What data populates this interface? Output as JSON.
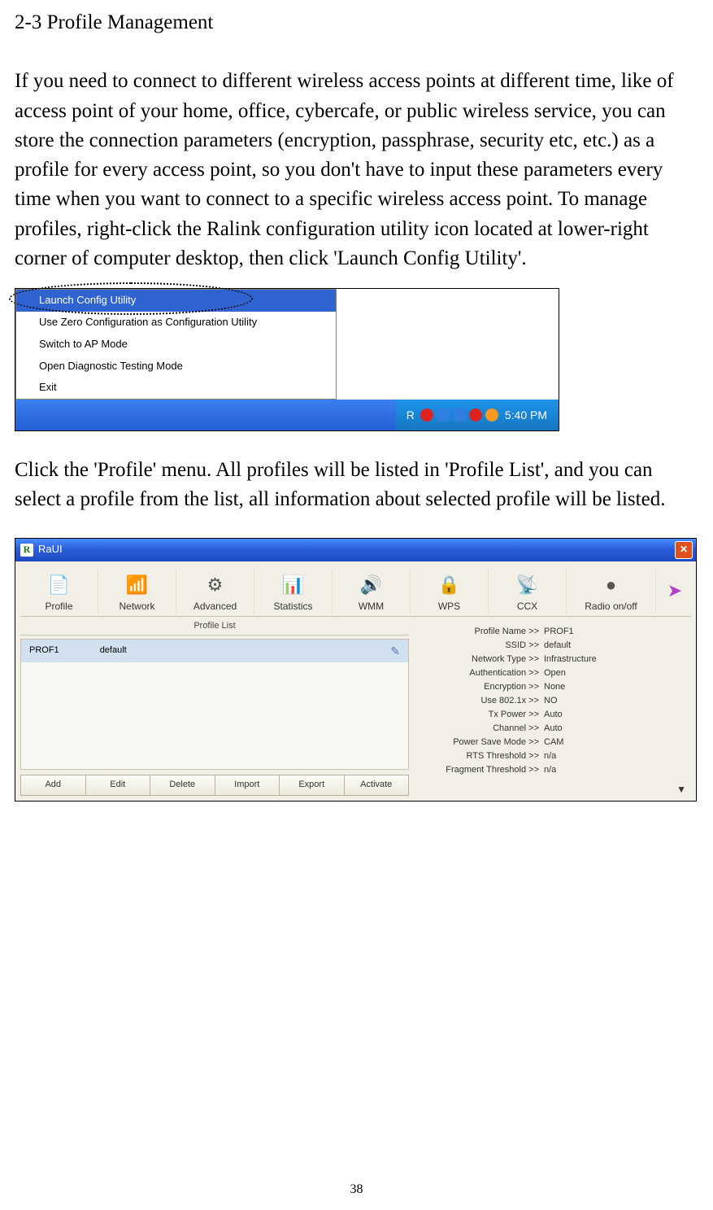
{
  "heading": "2-3 Profile Management",
  "para1": "If you need to connect to different wireless access points at different time, like of access point of your home, office, cybercafe, or public wireless service, you can store the connection parameters (encryption, passphrase, security etc, etc.) as a profile for every access point, so you don't have to input these parameters every time when you want to connect to a specific wireless access point. To manage profiles, right-click the Ralink configuration utility icon located at lower-right corner of computer desktop, then click 'Launch Config Utility'.",
  "context_menu": {
    "items": [
      "Launch Config Utility",
      "Use Zero Configuration as Configuration Utility",
      "Switch to AP Mode",
      "Open Diagnostic Testing Mode",
      "Exit"
    ]
  },
  "taskbar": {
    "clock": "5:40 PM"
  },
  "para2": "Click the 'Profile' menu. All profiles will be listed in 'Profile List', and you can select a profile from the list, all information about selected profile will be listed.",
  "raui": {
    "title": "RaUI",
    "tabs": [
      "Profile",
      "Network",
      "Advanced",
      "Statistics",
      "WMM",
      "WPS",
      "CCX",
      "Radio on/off"
    ],
    "profile_list": {
      "header": "Profile List",
      "rows": [
        {
          "name": "PROF1",
          "ssid": "default"
        }
      ]
    },
    "buttons": [
      "Add",
      "Edit",
      "Delete",
      "Import",
      "Export",
      "Activate"
    ],
    "details": [
      {
        "k": "Profile Name >>",
        "v": "PROF1"
      },
      {
        "k": "SSID >>",
        "v": "default"
      },
      {
        "k": "Network Type >>",
        "v": "Infrastructure"
      },
      {
        "k": "Authentication >>",
        "v": "Open"
      },
      {
        "k": "Encryption >>",
        "v": "None"
      },
      {
        "k": "Use 802.1x >>",
        "v": "NO"
      },
      {
        "k": "Tx Power >>",
        "v": "Auto"
      },
      {
        "k": "Channel >>",
        "v": "Auto"
      },
      {
        "k": "Power Save Mode >>",
        "v": "CAM"
      },
      {
        "k": "RTS Threshold >>",
        "v": "n/a"
      },
      {
        "k": "Fragment Threshold >>",
        "v": "n/a"
      }
    ]
  },
  "page_number": "38"
}
